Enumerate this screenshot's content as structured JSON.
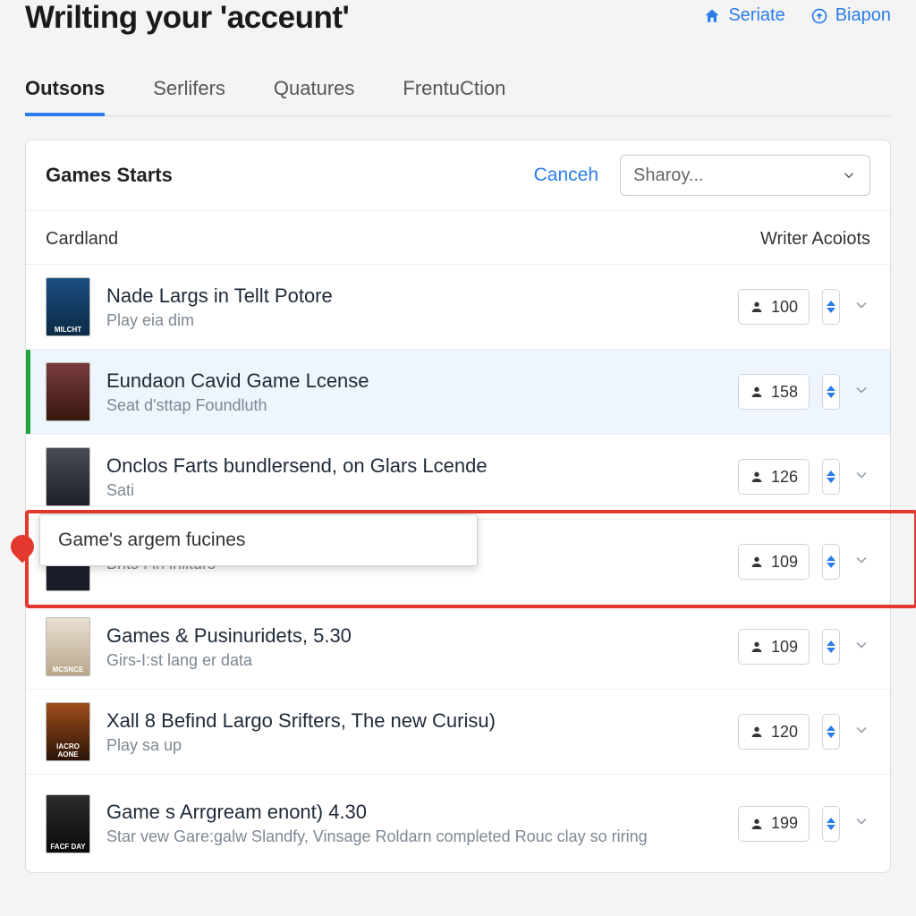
{
  "header": {
    "title": "Wrilting your 'acceunt'",
    "link1": "Seriate",
    "link2": "Biapon"
  },
  "tabs": {
    "t0": "Outsons",
    "t1": "Serlifers",
    "t2": "Quatures",
    "t3": "FrentuCtion"
  },
  "panel": {
    "title": "Games Starts",
    "cancel": "Canceh",
    "sort_placeholder": "Sharoy..."
  },
  "columns": {
    "left": "Cardland",
    "right": "Writer Acoiots"
  },
  "tooltip": "Game's argem fucines",
  "rows": [
    {
      "title": "Nade Largs in Tellt Potore",
      "sub": "Play eia dim",
      "count": "100",
      "cover": "MILCHT"
    },
    {
      "title": "Eundaon Cavid Game Lcense",
      "sub": "Seat d'sttap Foundluth",
      "count": "158",
      "cover": ""
    },
    {
      "title": "Onclos Farts bundlersend, on Glars Lcende",
      "sub": "Sati",
      "count": "126",
      "cover": ""
    },
    {
      "title": "",
      "sub": "Brits I in inliturs",
      "count": "109",
      "cover": ""
    },
    {
      "title": "Games & Pusinuridets, 5.30",
      "sub": "Girs-I:st lang er data",
      "count": "109",
      "cover": "MCSNCE"
    },
    {
      "title": "Xall 8 Befind Largo Srifters, The new Curisu)",
      "sub": "Play sa up",
      "count": "120",
      "cover": "IACRO AONE"
    },
    {
      "title": "Game s Arrgream enont) 4.30",
      "sub": "Star vew Gare:galw Slandfy, Vinsage Roldarn completed Rouc clay so riring",
      "count": "199",
      "cover": "FACF DAY"
    }
  ]
}
